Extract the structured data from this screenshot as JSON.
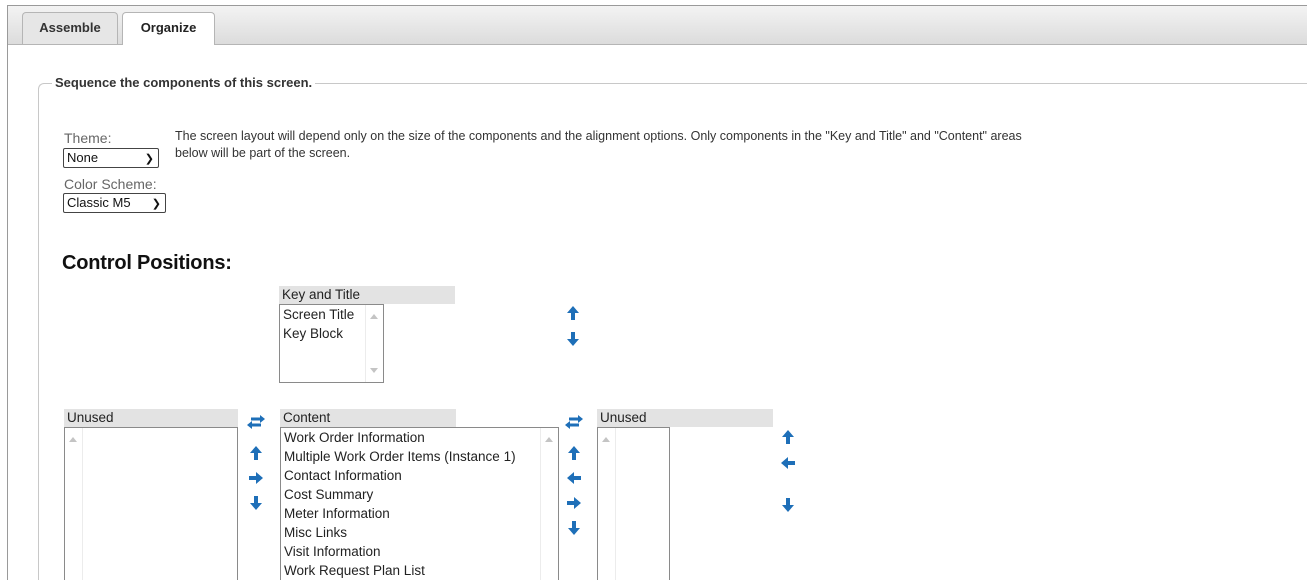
{
  "tabs": [
    {
      "label": "Assemble",
      "active": false
    },
    {
      "label": "Organize",
      "active": true
    }
  ],
  "section": {
    "legend": "Sequence the components of this screen.",
    "description": "The screen layout will depend only on the size of the components and the alignment options. Only components in the \"Key and Title\" and \"Content\" areas below will be part of the screen."
  },
  "theme": {
    "label": "Theme:",
    "value": "None"
  },
  "color_scheme": {
    "label": "Color Scheme:",
    "value": "Classic M5"
  },
  "control_positions": {
    "heading": "Control Positions:",
    "key_and_title": {
      "header": "Key and Title",
      "items": [
        "Screen Title",
        "Key Block"
      ]
    },
    "left_unused": {
      "header": "Unused",
      "items": []
    },
    "content": {
      "header": "Content",
      "items": [
        "Work Order Information",
        "Multiple Work Order Items (Instance 1)",
        "Contact Information",
        "Cost Summary",
        "Meter Information",
        "Misc Links",
        "Visit Information",
        "Work Request Plan List"
      ]
    },
    "right_unused": {
      "header": "Unused",
      "items": []
    }
  },
  "icons": {
    "color": "#1e6fb8"
  }
}
